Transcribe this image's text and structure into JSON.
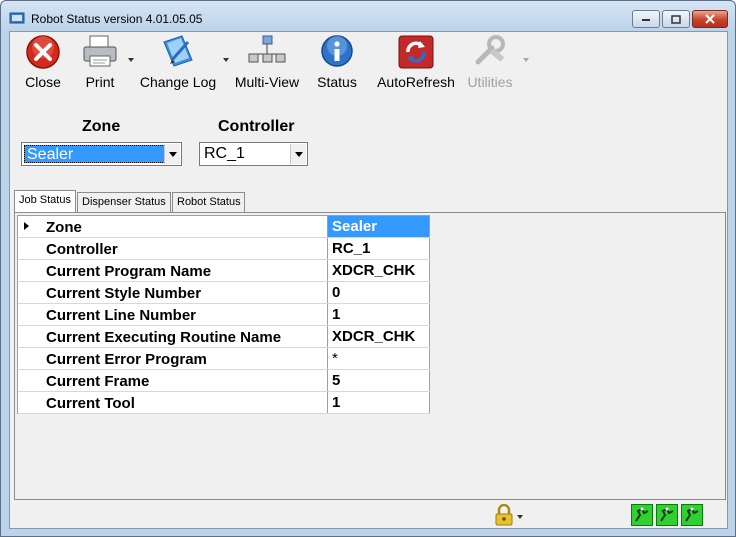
{
  "window": {
    "title": "Robot Status  version  4.01.05.05"
  },
  "toolbar": {
    "buttons": [
      {
        "label": "Close",
        "icon": "close-x-icon",
        "has_dropdown": false,
        "enabled": true
      },
      {
        "label": "Print",
        "icon": "printer-icon",
        "has_dropdown": true,
        "enabled": true
      },
      {
        "label": "Change Log",
        "icon": "change-log-icon",
        "has_dropdown": true,
        "enabled": true
      },
      {
        "label": "Multi-View",
        "icon": "network-icon",
        "has_dropdown": false,
        "enabled": true
      },
      {
        "label": "Status",
        "icon": "info-icon",
        "has_dropdown": false,
        "enabled": true
      },
      {
        "label": "AutoRefresh",
        "icon": "auto-refresh-icon",
        "has_dropdown": false,
        "enabled": true
      },
      {
        "label": "Utilities",
        "icon": "utilities-icon",
        "has_dropdown": true,
        "enabled": false
      }
    ]
  },
  "selectors": {
    "zone_label": "Zone",
    "zone_value": "Sealer",
    "controller_label": "Controller",
    "controller_value": "RC_1"
  },
  "tabs": [
    {
      "label": "Job Status",
      "active": true
    },
    {
      "label": "Dispenser Status",
      "active": false
    },
    {
      "label": "Robot Status",
      "active": false
    }
  ],
  "grid": {
    "rows": [
      {
        "label": "Zone",
        "value": "Sealer"
      },
      {
        "label": "Controller",
        "value": "RC_1"
      },
      {
        "label": "Current Program Name",
        "value": "XDCR_CHK"
      },
      {
        "label": "Current Style Number",
        "value": "0"
      },
      {
        "label": "Current Line Number",
        "value": "1"
      },
      {
        "label": "Current Executing Routine Name",
        "value": "XDCR_CHK"
      },
      {
        "label": "Current Error Program",
        "value": "*"
      },
      {
        "label": "Current Frame",
        "value": "5"
      },
      {
        "label": "Current Tool",
        "value": "1"
      }
    ]
  },
  "statusbar": {
    "lock_icon": "padlock-icon",
    "indicator_color": "#2fd02f",
    "indicators": [
      "robot-status-icon",
      "robot-status-icon",
      "robot-status-icon"
    ]
  },
  "colors": {
    "selection": "#3399ff",
    "close_red": "#d42a1c"
  }
}
